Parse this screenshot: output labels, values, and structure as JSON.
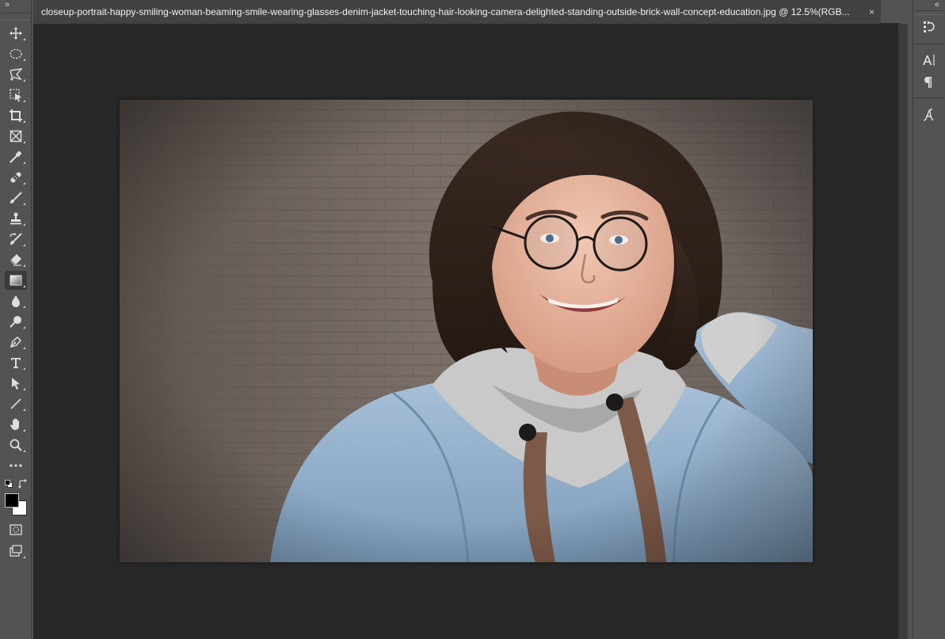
{
  "document": {
    "tab_title": "closeup-portrait-happy-smiling-woman-beaming-smile-wearing-glasses-denim-jacket-touching-hair-looking-camera-delighted-standing-outside-brick-wall-concept-education.jpg @ 12.5%(RGB...",
    "close_glyph": "×",
    "zoom": "12.5%",
    "color_mode": "RGB"
  },
  "toolbar": {
    "collapse_glyph": "»",
    "tools": [
      {
        "name": "move-tool",
        "icon": "move-icon"
      },
      {
        "name": "elliptical-marquee-tool",
        "icon": "ellipse-marquee-icon"
      },
      {
        "name": "polygonal-lasso-tool",
        "icon": "polygonal-lasso-icon"
      },
      {
        "name": "object-selection-tool",
        "icon": "object-selection-icon"
      },
      {
        "name": "crop-tool",
        "icon": "crop-icon"
      },
      {
        "name": "frame-tool",
        "icon": "frame-icon"
      },
      {
        "name": "eyedropper-tool",
        "icon": "eyedropper-icon"
      },
      {
        "name": "healing-brush-tool",
        "icon": "bandage-icon"
      },
      {
        "name": "brush-tool",
        "icon": "brush-icon"
      },
      {
        "name": "clone-stamp-tool",
        "icon": "stamp-icon"
      },
      {
        "name": "history-brush-tool",
        "icon": "history-brush-icon"
      },
      {
        "name": "eraser-tool",
        "icon": "eraser-icon"
      },
      {
        "name": "gradient-tool",
        "icon": "gradient-icon",
        "active": true
      },
      {
        "name": "blur-tool",
        "icon": "droplet-icon"
      },
      {
        "name": "dodge-tool",
        "icon": "dodge-icon"
      },
      {
        "name": "pen-tool",
        "icon": "pen-icon"
      },
      {
        "name": "type-tool",
        "icon": "type-icon"
      },
      {
        "name": "path-selection-tool",
        "icon": "arrow-select-icon"
      },
      {
        "name": "line-tool",
        "icon": "line-icon"
      },
      {
        "name": "hand-tool",
        "icon": "hand-icon"
      },
      {
        "name": "zoom-tool",
        "icon": "magnifier-icon"
      },
      {
        "name": "edit-toolbar",
        "icon": "ellipsis-icon"
      }
    ],
    "foreground_color": "#000000",
    "background_color": "#ffffff"
  },
  "right_dock": {
    "collapse_glyph": "«",
    "panels": [
      {
        "name": "history-panel-button",
        "icon": "history-icon"
      },
      {
        "name": "character-panel-button",
        "icon": "character-icon"
      },
      {
        "name": "paragraph-panel-button",
        "icon": "paragraph-icon"
      },
      {
        "name": "glyphs-panel-button",
        "icon": "glyphs-icon"
      }
    ]
  },
  "colors": {
    "ui_panel": "#535353",
    "canvas_bg": "#282828",
    "tab_bg": "#424242",
    "icon": "#dedede"
  }
}
